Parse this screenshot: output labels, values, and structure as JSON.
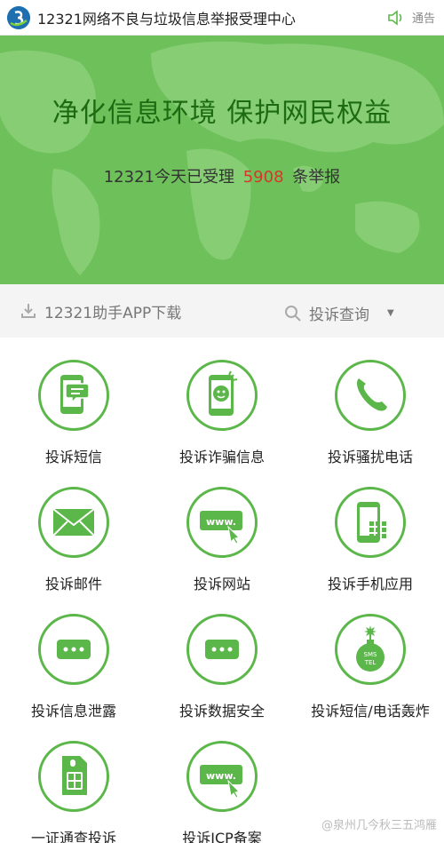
{
  "header": {
    "title": "12321网络不良与垃圾信息举报受理中心",
    "notice_label": "通告",
    "logo_icon": "12321-logo-icon"
  },
  "banner": {
    "title": "净化信息环境 保护网民权益",
    "stat_prefix": "12321今天已受理",
    "stat_count": "5908",
    "stat_suffix": "条举报",
    "bg_color": "#6dc05a",
    "count_color": "#d6372a"
  },
  "toolbar": {
    "download_label": "12321助手APP下载",
    "query_label": "投诉查询"
  },
  "grid": {
    "items": [
      {
        "label": "投诉短信",
        "icon": "sms-icon"
      },
      {
        "label": "投诉诈骗信息",
        "icon": "scam-icon"
      },
      {
        "label": "投诉骚扰电话",
        "icon": "phone-icon"
      },
      {
        "label": "投诉邮件",
        "icon": "mail-icon"
      },
      {
        "label": "投诉网站",
        "icon": "website-icon"
      },
      {
        "label": "投诉手机应用",
        "icon": "mobile-app-icon"
      },
      {
        "label": "投诉信息泄露",
        "icon": "info-leak-icon"
      },
      {
        "label": "投诉数据安全",
        "icon": "data-security-icon"
      },
      {
        "label": "投诉短信/电话轰炸",
        "icon": "sms-bomb-icon"
      },
      {
        "label": "一证通查投诉",
        "icon": "sim-card-icon"
      },
      {
        "label": "投诉ICP备案",
        "icon": "icp-icon"
      }
    ],
    "accent": "#5cb74a"
  },
  "watermark": "@泉州几今秋三五鸿雁"
}
